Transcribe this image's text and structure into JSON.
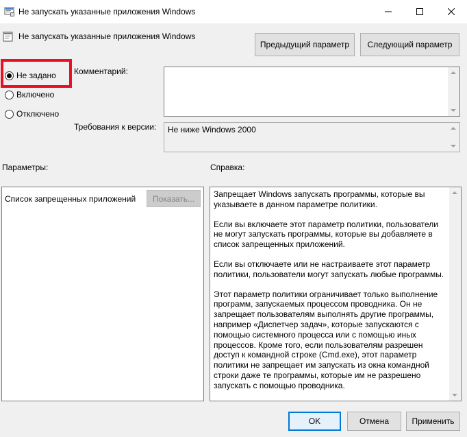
{
  "window": {
    "title": "Не запускать указанные приложения Windows",
    "minimize_icon": "minimize-icon",
    "maximize_icon": "maximize-icon",
    "close_icon": "close-icon"
  },
  "header": {
    "policy_name": "Не запускать указанные приложения Windows",
    "prev_button": "Предыдущий параметр",
    "next_button": "Следующий параметр"
  },
  "state": {
    "options": [
      {
        "label": "Не задано",
        "selected": true
      },
      {
        "label": "Включено",
        "selected": false
      },
      {
        "label": "Отключено",
        "selected": false
      }
    ],
    "highlight_color": "#e81123"
  },
  "comment": {
    "label": "Комментарий:",
    "value": ""
  },
  "supported": {
    "label": "Требования к версии:",
    "value": "Не ниже Windows 2000"
  },
  "options_panel": {
    "heading": "Параметры:",
    "list_label": "Список запрещенных приложений",
    "show_button": "Показать..."
  },
  "help_panel": {
    "heading": "Справка:",
    "paragraphs": [
      "Запрещает Windows запускать программы, которые вы указываете в данном параметре политики.",
      "Если вы включаете этот параметр политики, пользователи не могут запускать программы, которые вы добавляете в список запрещенных приложений.",
      "Если вы отключаете или не настраиваете этот параметр политики, пользователи могут запускать любые программы.",
      "Этот параметр политики ограничивает только выполнение программ, запускаемых процессом проводника. Он не запрещает пользователям выполнять другие программы, например «Диспетчер задач», которые запускаются с помощью системного процесса или с помощью иных процессов.  Кроме того, если пользователям разрешен доступ к командной строке (Cmd.exe), этот параметр политики не запрещает им запускать из окна командной строки даже те программы, которые им не разрешено запускать с помощью проводника."
    ]
  },
  "footer": {
    "ok": "OK",
    "cancel": "Отмена",
    "apply": "Применить"
  },
  "colors": {
    "accent": "#0078d7",
    "background": "#f0f0f0"
  }
}
